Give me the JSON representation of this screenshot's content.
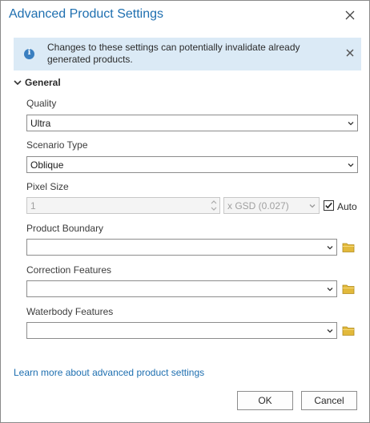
{
  "dialog": {
    "title": "Advanced Product Settings",
    "close_icon": "close-icon"
  },
  "banner": {
    "message": "Changes to these settings can potentially invalidate already generated products.",
    "icon": "info-icon",
    "close_icon": "close-icon"
  },
  "section": {
    "label": "General",
    "expanded": true
  },
  "fields": {
    "quality": {
      "label": "Quality",
      "value": "Ultra"
    },
    "scenario_type": {
      "label": "Scenario Type",
      "value": "Oblique"
    },
    "pixel_size": {
      "label": "Pixel Size",
      "value": "1",
      "unit": "x GSD (0.027)",
      "auto_label": "Auto",
      "auto_checked": true
    },
    "product_boundary": {
      "label": "Product Boundary",
      "value": ""
    },
    "correction_features": {
      "label": "Correction Features",
      "value": ""
    },
    "waterbody_features": {
      "label": "Waterbody Features",
      "value": ""
    }
  },
  "footer": {
    "link": "Learn more about advanced product settings",
    "ok_label": "OK",
    "cancel_label": "Cancel"
  },
  "colors": {
    "title": "#1e6fb0",
    "banner_bg": "#dbeaf6",
    "folder": "#e2b93b"
  }
}
